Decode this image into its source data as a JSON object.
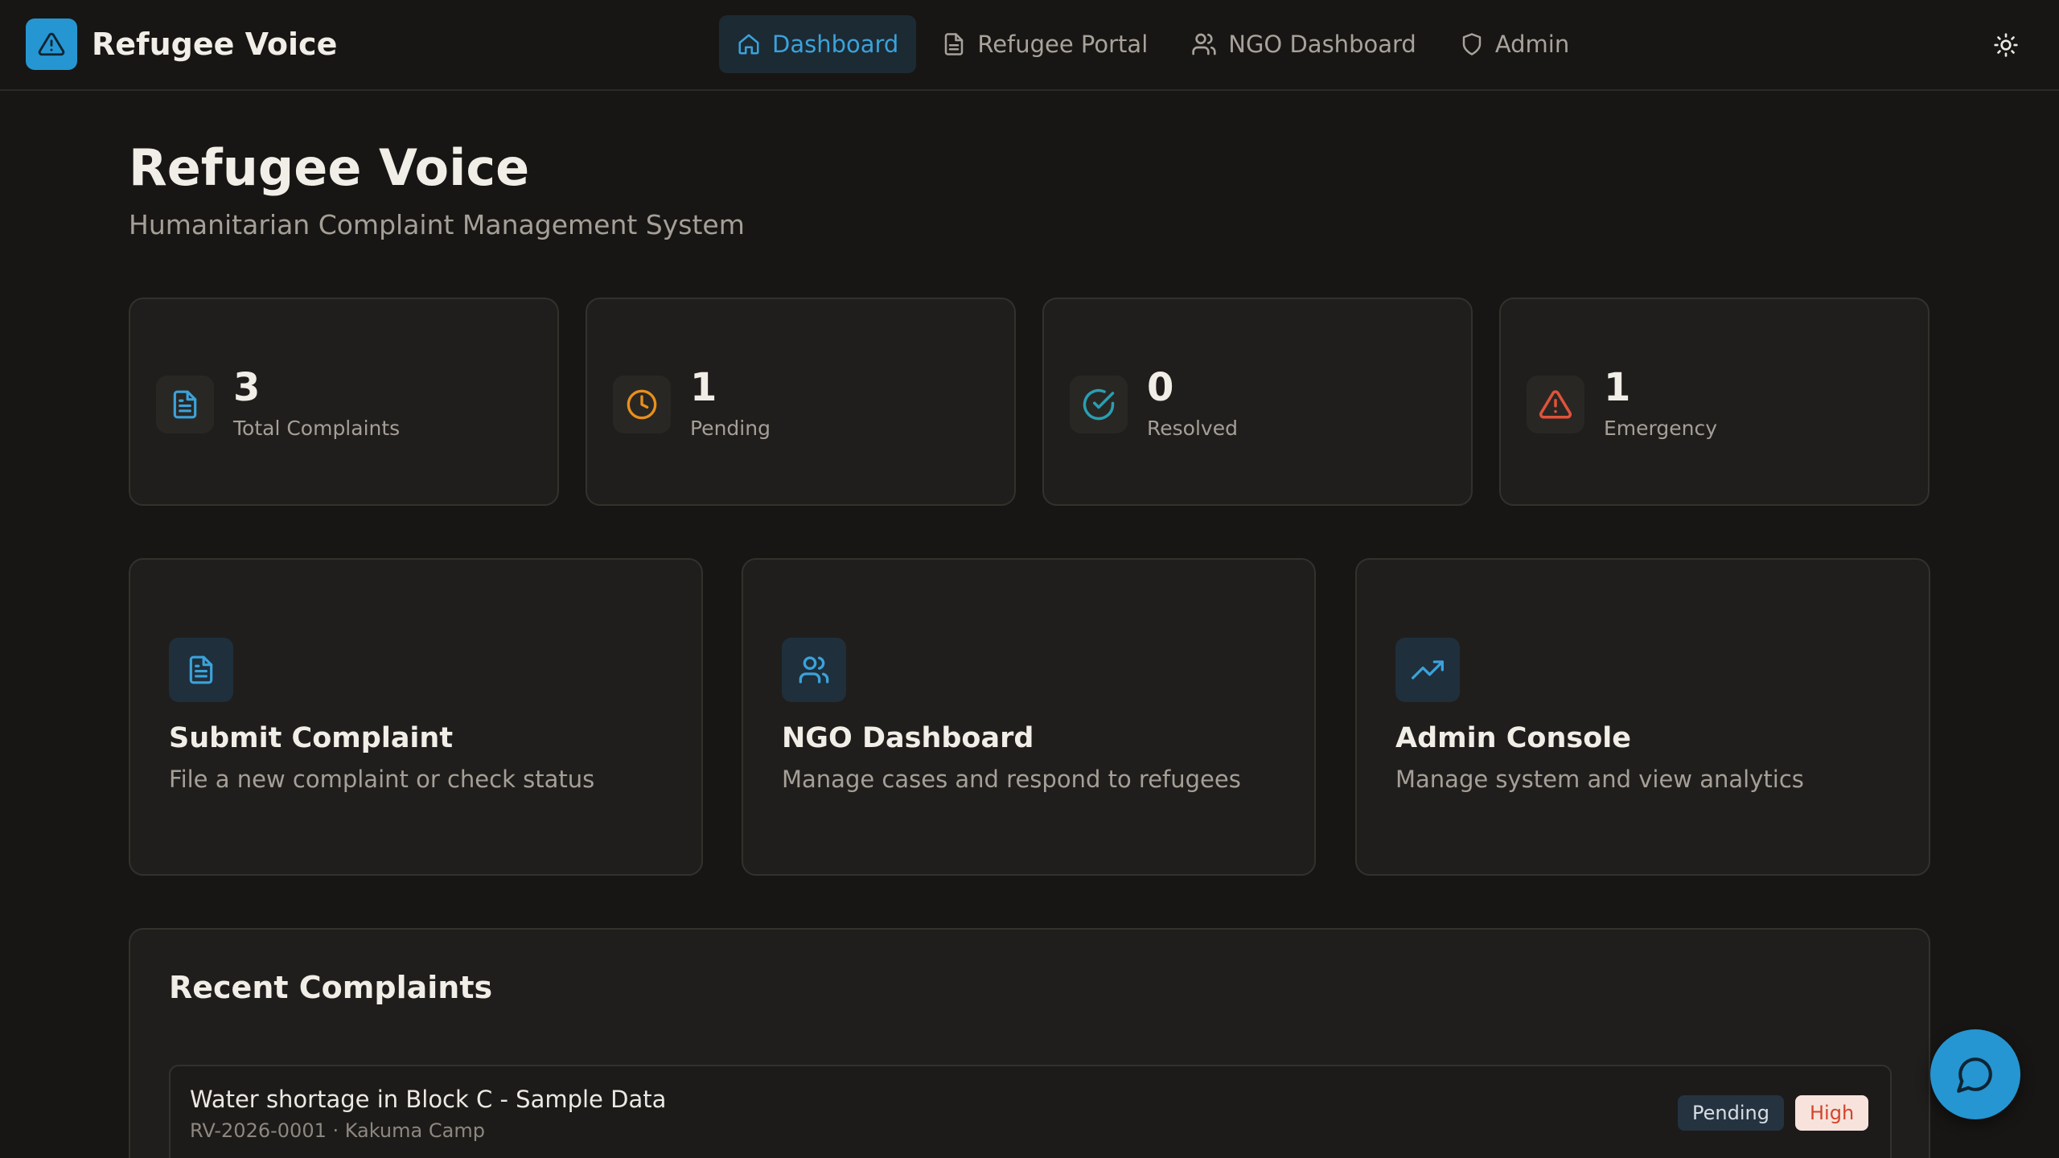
{
  "app": {
    "name": "Refugee Voice"
  },
  "nav": {
    "items": [
      {
        "label": "Dashboard",
        "icon": "home-icon",
        "active": true
      },
      {
        "label": "Refugee Portal",
        "icon": "document-icon",
        "active": false
      },
      {
        "label": "NGO Dashboard",
        "icon": "users-icon",
        "active": false
      },
      {
        "label": "Admin",
        "icon": "shield-icon",
        "active": false
      }
    ],
    "theme_toggle_icon": "sun-icon"
  },
  "header": {
    "title": "Refugee Voice",
    "subtitle": "Humanitarian Complaint Management System"
  },
  "stats": [
    {
      "value": "3",
      "label": "Total Complaints",
      "icon": "document-icon",
      "color": "#3ba2da"
    },
    {
      "value": "1",
      "label": "Pending",
      "icon": "clock-icon",
      "color": "#e8901c"
    },
    {
      "value": "0",
      "label": "Resolved",
      "icon": "check-circle-icon",
      "color": "#2a9fb0"
    },
    {
      "value": "1",
      "label": "Emergency",
      "icon": "alert-triangle-icon",
      "color": "#e0533a"
    }
  ],
  "actions": [
    {
      "title": "Submit Complaint",
      "description": "File a new complaint or check status",
      "icon": "document-icon"
    },
    {
      "title": "NGO Dashboard",
      "description": "Manage cases and respond to refugees",
      "icon": "users-icon"
    },
    {
      "title": "Admin Console",
      "description": "Manage system and view analytics",
      "icon": "trending-up-icon"
    }
  ],
  "recent": {
    "title": "Recent Complaints",
    "items": [
      {
        "title": "Water shortage in Block C - Sample Data",
        "meta": "RV-2026-0001 · Kakuma Camp",
        "status": "Pending",
        "priority": "High"
      }
    ]
  },
  "colors": {
    "accent": "#2596d1",
    "background": "#171614",
    "card": "#201e1c",
    "priority_high": "#d2452b"
  },
  "chat": {
    "icon": "chat-bubble-icon"
  }
}
